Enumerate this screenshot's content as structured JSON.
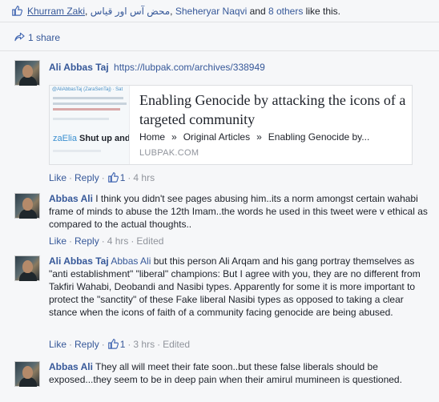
{
  "likes": {
    "names": [
      "Khurram Zaki",
      "محض آس اور قیاس",
      "Sheheryar Naqvi"
    ],
    "comma": ",",
    "and": "and",
    "others": "8 others",
    "suffix": "like this."
  },
  "shares": {
    "label": "1 share"
  },
  "comments": [
    {
      "author": "Ali Abbas Taj",
      "text": "https://lubpak.com/archives/338949",
      "link_preview": {
        "title": "Enabling Genocide by attacking the icons of a targeted community",
        "breadcrumb": [
          "Home",
          "Original Articles",
          "Enabling Genocide by..."
        ],
        "separator": "»",
        "domain": "LUBPAK.COM",
        "thumb_caption_tag": "zaElia",
        "thumb_caption": "Shut up and get l",
        "thumb_small_text": "@AliAbbasTaj (ZaraSenTaj) · Sat"
      },
      "actions": {
        "like": "Like",
        "reply": "Reply",
        "like_count": "1",
        "time": "4 hrs",
        "edited": ""
      }
    },
    {
      "author": "Abbas Ali",
      "text": "I think you didn't see pages abusing him..its a norm amongst certain wahabi frame of minds to abuse the 12th Imam..the words he used in this tweet were v ethical as compared to the actual thoughts..",
      "actions": {
        "like": "Like",
        "reply": "Reply",
        "like_count": "",
        "time": "4 hrs",
        "edited": "Edited"
      }
    },
    {
      "author": "Ali Abbas Taj",
      "mention": "Abbas Ali",
      "text": "but this person Ali Arqam and his gang portray themselves as \"anti establishment\" \"liberal\" champions: But I agree with you, they are no different from Takfiri Wahabi, Deobandi and Nasibi types. Apparently for some it is more important to protect the \"sanctity\" of these Fake liberal Nasibi types as opposed to taking a clear stance when the icons of faith of a community facing genocide are being abused.",
      "actions": {
        "like": "Like",
        "reply": "Reply",
        "like_count": "1",
        "time": "3 hrs",
        "edited": "Edited"
      }
    },
    {
      "author": "Abbas Ali",
      "text": "They all will meet their fate soon..but these false liberals should be exposed...they seem to be in deep pain when their amirul mumineen is questioned.",
      "actions": {
        "like": "",
        "reply": "",
        "like_count": "",
        "time": "",
        "edited": ""
      }
    }
  ],
  "colors": {
    "link": "#365899",
    "meta": "#90949c",
    "text": "#1d2129",
    "background": "#f6f7f9"
  },
  "icons": {
    "like": "thumbs-up-icon",
    "share": "share-arrow-icon"
  }
}
